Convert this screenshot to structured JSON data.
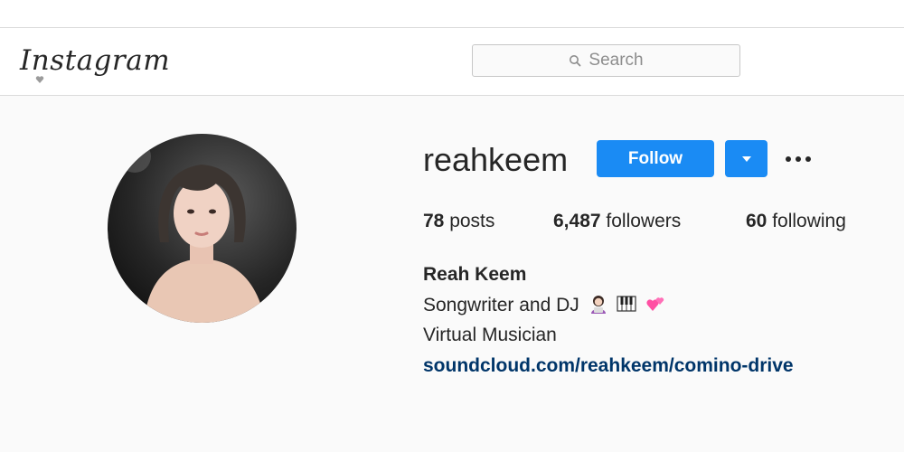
{
  "header": {
    "logo_text": "Instagram",
    "search_placeholder": "Search"
  },
  "profile": {
    "username": "reahkeem",
    "follow_label": "Follow",
    "stats": {
      "posts_count": "78",
      "posts_label": "posts",
      "followers_count": "6,487",
      "followers_label": "followers",
      "following_count": "60",
      "following_label": "following"
    },
    "bio": {
      "name": "Reah Keem",
      "line1": "Songwriter and DJ",
      "line1_emojis": [
        "woman-technologist-emoji",
        "piano-emoji",
        "two-hearts-emoji"
      ],
      "line2": "Virtual Musician",
      "link": "soundcloud.com/reahkeem/comino-drive"
    }
  },
  "colors": {
    "accent": "#1a8bf4",
    "link": "#003569",
    "text": "#262626",
    "muted": "#8e8e8e",
    "background": "#fafafa"
  }
}
